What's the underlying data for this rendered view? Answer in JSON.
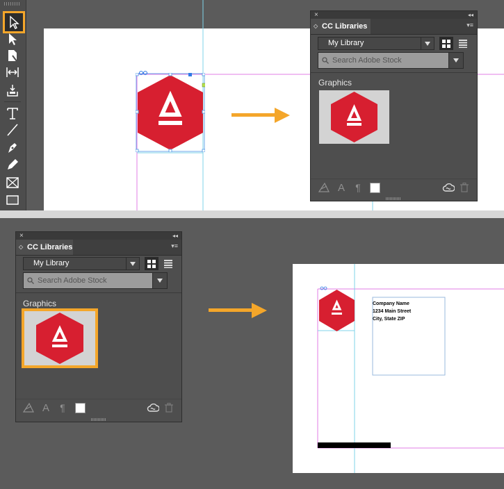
{
  "panel": {
    "title": "CC Libraries",
    "library": "My Library",
    "search_placeholder": "Search Adobe Stock",
    "group_label": "Graphics",
    "close_glyph": "×",
    "collapse_glyph": "◂◂",
    "menu_glyph": "▾≡"
  },
  "address": {
    "line1": "Company Name",
    "line2": "1234 Main Street",
    "line3": "City, State ZIP"
  },
  "colors": {
    "accent_orange": "#f4a62a",
    "logo_red": "#d71f30",
    "guide_cyan": "#7fd3ea",
    "guide_magenta": "#e27ee6"
  },
  "tools": [
    "selection-tool",
    "direct-selection-tool",
    "page-tool",
    "gap-tool",
    "content-collector-tool",
    "type-tool",
    "line-tool",
    "pen-tool",
    "pencil-tool",
    "rectangle-frame-tool",
    "rectangle-tool"
  ]
}
